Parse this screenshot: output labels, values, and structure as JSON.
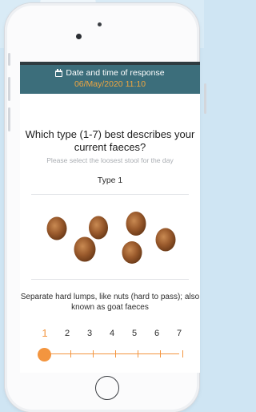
{
  "header": {
    "title": "Date and time of response",
    "datetime": "06/May/2020 11:10",
    "icon": "calendar-icon"
  },
  "question": {
    "text": "Which type (1-7) best describes your current faeces?",
    "hint": "Please select the loosest  stool for the day"
  },
  "selection": {
    "type_label": "Type 1",
    "description": "Separate hard lumps, like nuts (hard to pass); also known as goat faeces",
    "image": "stool-type-1-illustration"
  },
  "scale": {
    "options": [
      "1",
      "2",
      "3",
      "4",
      "5",
      "6",
      "7"
    ],
    "selected_index": 0
  },
  "colors": {
    "banner": "#3c6e7b",
    "accent": "#f3953f",
    "datetime": "#f0a640"
  }
}
